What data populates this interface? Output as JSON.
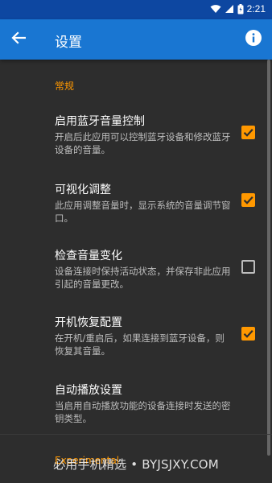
{
  "status_bar": {
    "time": "2:21"
  },
  "app_bar": {
    "title": "设置",
    "back_icon": "back-arrow-icon",
    "info_icon": "info-icon"
  },
  "section_general": "常规",
  "items": [
    {
      "title": "启用蓝牙音量控制",
      "summary": "开启后此应用可以控制蓝牙设备和修改蓝牙设备的音量。",
      "checked": true
    },
    {
      "title": "可视化调整",
      "summary": "此应用调整音量时，显示系统的音量调节窗口。",
      "checked": true
    },
    {
      "title": "检查音量变化",
      "summary": "设备连接时保持活动状态，并保存非此应用引起的音量更改。",
      "checked": false
    },
    {
      "title": "开机恢复配置",
      "summary": "在开机/重启后，如果连接到蓝牙设备，则恢复其音量。",
      "checked": true
    },
    {
      "title": "自动播放设置",
      "summary": "当启用自动播放功能的设备连接时发送的密钥类型。"
    }
  ],
  "section_experimental": "Experimental",
  "watermark": "必用手机精选 • BYJSJXY.COM",
  "colors": {
    "accent": "#ff9800",
    "app_bar": "#1976d2",
    "status_bar": "#0d47a1",
    "background": "#2d2d2d"
  }
}
